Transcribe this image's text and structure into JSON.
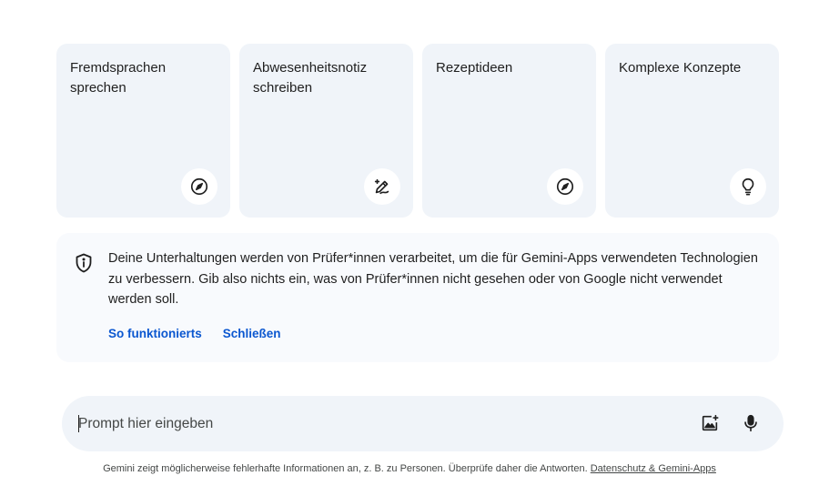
{
  "cards": [
    {
      "title": "Fremdsprachen sprechen",
      "icon": "compass-icon"
    },
    {
      "title": "Abwesenheitsnotiz schreiben",
      "icon": "pen-sparkle-icon"
    },
    {
      "title": "Rezeptideen",
      "icon": "compass-icon"
    },
    {
      "title": "Komplexe Konzepte",
      "icon": "lightbulb-icon"
    }
  ],
  "notice": {
    "icon": "shield-info-icon",
    "text": "Deine Unterhaltungen werden von Prüfer*innen verarbeitet, um die für Gemini-Apps verwendeten Technologien zu verbessern. Gib also nichts ein, was von Prüfer*innen nicht gesehen oder von Google nicht verwendet werden soll.",
    "link_how": "So funktionierts",
    "link_close": "Schließen"
  },
  "prompt": {
    "placeholder": "Prompt hier eingeben",
    "value": "",
    "image_button_icon": "add-image-icon",
    "mic_button_icon": "microphone-icon"
  },
  "footer": {
    "text": "Gemini zeigt möglicherweise fehlerhafte Informationen an, z. B. zu Personen. Überprüfe daher die Antworten.",
    "link": "Datenschutz & Gemini-Apps"
  },
  "colors": {
    "card_bg": "#f0f4f9",
    "link": "#0b57d0",
    "text": "#1f1f1f"
  }
}
